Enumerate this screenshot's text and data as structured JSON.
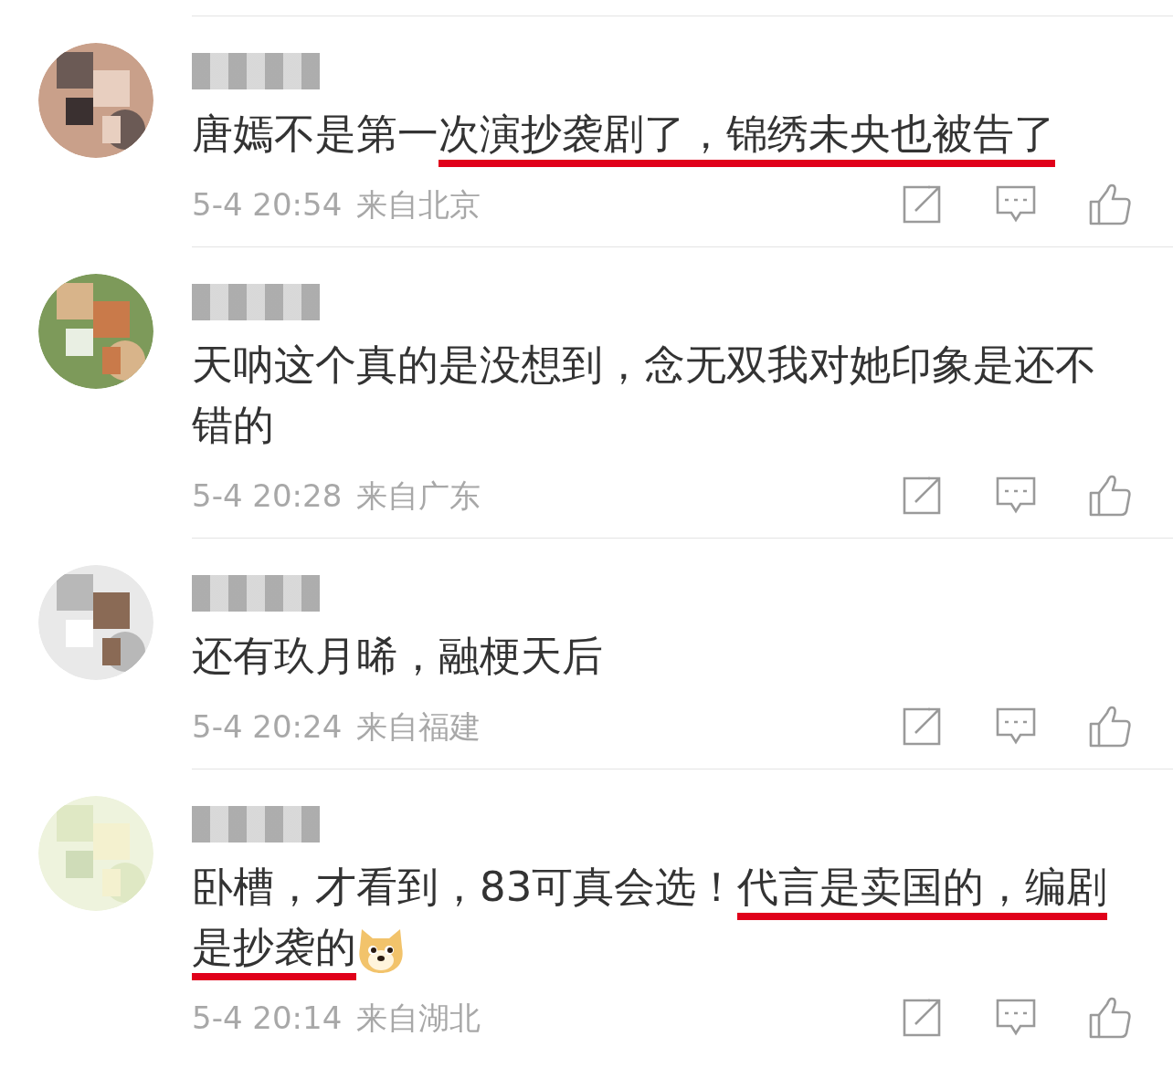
{
  "comments": [
    {
      "name_redacted": true,
      "segments": [
        {
          "kind": "text",
          "text": "唐嫣不是第一",
          "underlined": false
        },
        {
          "kind": "text",
          "text": "次演抄袭剧了，锦绣未央也被告了",
          "underlined": true
        }
      ],
      "time": "5-4 20:54",
      "source": "来自北京"
    },
    {
      "name_redacted": true,
      "segments": [
        {
          "kind": "text",
          "text": "天呐这个真的是没想到，念无双我对她印象是还不错的",
          "underlined": false
        }
      ],
      "time": "5-4 20:28",
      "source": "来自广东"
    },
    {
      "name_redacted": true,
      "segments": [
        {
          "kind": "text",
          "text": "还有玖月晞，融梗天后",
          "underlined": false
        }
      ],
      "time": "5-4 20:24",
      "source": "来自福建"
    },
    {
      "name_redacted": true,
      "segments": [
        {
          "kind": "text",
          "text": "卧槽，才看到，83可真会选！",
          "underlined": false
        },
        {
          "kind": "text",
          "text": "代言是卖国的，编剧是抄袭的",
          "underlined": true
        },
        {
          "kind": "emoji"
        }
      ],
      "time": "5-4 20:14",
      "source": "来自湖北"
    }
  ]
}
